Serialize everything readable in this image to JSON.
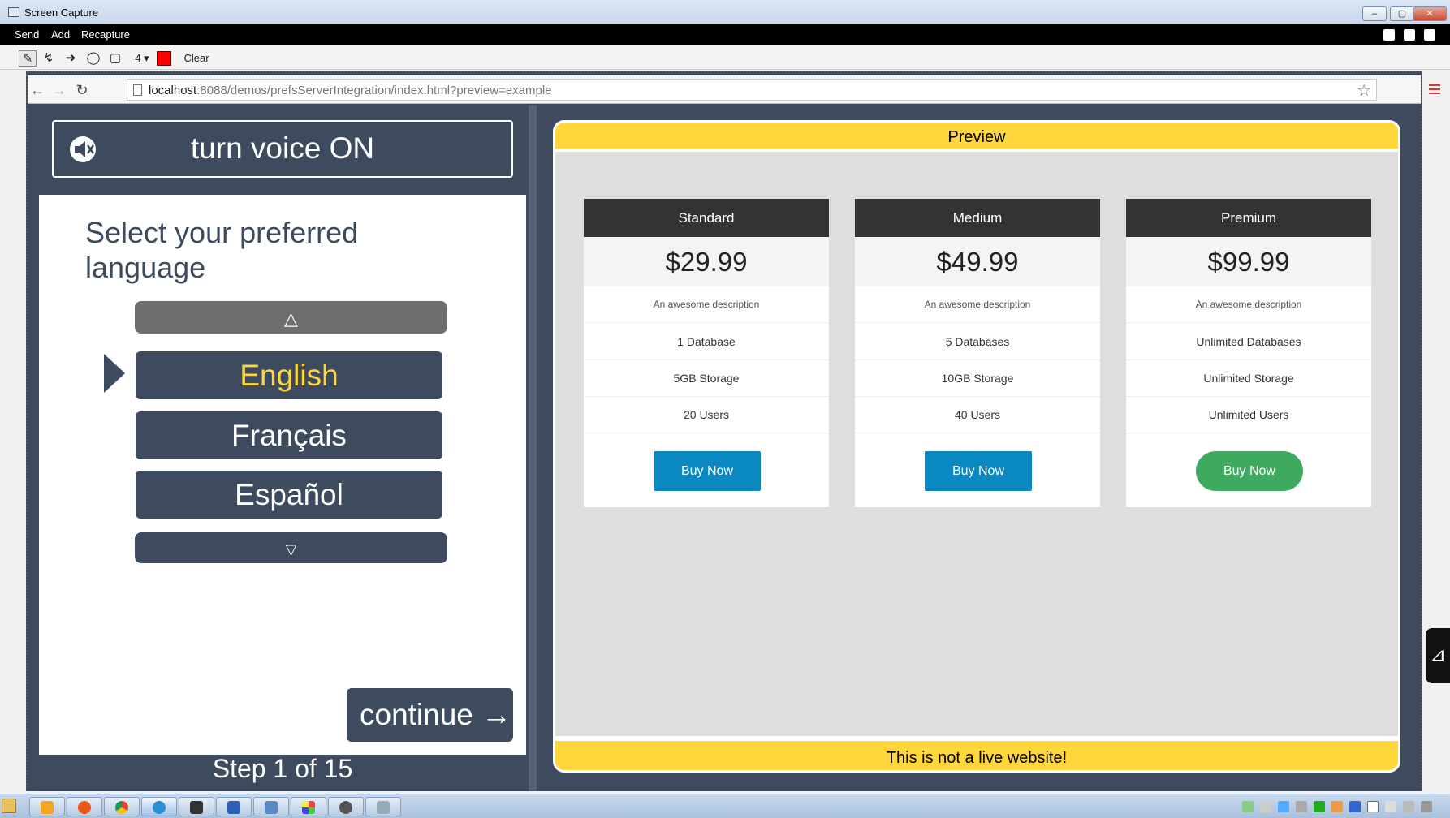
{
  "window": {
    "title": "Screen Capture",
    "controls": {
      "minimize": "–",
      "maximize": "▢",
      "close": "✕"
    }
  },
  "menu": {
    "items": [
      "Send",
      "Add",
      "Recapture"
    ],
    "icons": [
      "document-icon",
      "download-icon",
      "print-icon"
    ]
  },
  "toolbar": {
    "tools": [
      "pen-icon",
      "curve-icon",
      "arrow-icon",
      "circle-icon",
      "rectangle-icon"
    ],
    "line_width": "4 ▾",
    "color": "#ff0000",
    "clear_label": "Clear"
  },
  "browser": {
    "back": "←",
    "forward": "→",
    "reload": "↻",
    "url_host": "localhost",
    "url_rest": ":8088/demos/prefsServerIntegration/index.html?preview=example",
    "star": "☆"
  },
  "prefs": {
    "voice_button_label": "turn voice ON",
    "prompt": "Select your preferred language",
    "scroll_up": "△",
    "scroll_down": "▽",
    "languages": [
      {
        "label": "English",
        "selected": true
      },
      {
        "label": "Français",
        "selected": false
      },
      {
        "label": "Español",
        "selected": false
      }
    ],
    "continue_label": "continue →",
    "step_label": "Step 1 of 15",
    "selected_color": "#ffd73b",
    "panel_color": "#3e4a5e"
  },
  "preview": {
    "header": "Preview",
    "footer": "This is not a live website!",
    "accent": "#ffd73b",
    "plans": [
      {
        "name": "Standard",
        "price": "$29.99",
        "description": "An awesome description",
        "features": [
          "1 Database",
          "5GB Storage",
          "20 Users"
        ],
        "button": "Buy Now",
        "button_color": "#0a88c1"
      },
      {
        "name": "Medium",
        "price": "$49.99",
        "description": "An awesome description",
        "features": [
          "5 Databases",
          "10GB Storage",
          "40 Users"
        ],
        "button": "Buy Now",
        "button_color": "#0a88c1"
      },
      {
        "name": "Premium",
        "price": "$99.99",
        "description": "An awesome description",
        "features": [
          "Unlimited Databases",
          "Unlimited Storage",
          "Unlimited Users"
        ],
        "button": "Buy Now",
        "button_color": "#3daa60"
      }
    ]
  },
  "side_tab": {
    "icon": "puzzle-icon",
    "glyph": "⊿"
  },
  "taskbar": {
    "apps": [
      "windows-explorer-icon",
      "media-player-icon",
      "firefox-icon",
      "chrome-icon",
      "internet-explorer-icon",
      "terminal-icon",
      "word-icon",
      "remote-desktop-icon",
      "paint-icon",
      "settings-icon",
      "screen-capture-icon"
    ],
    "tray": [
      "network-icon",
      "lock-icon",
      "mail-icon",
      "drive-icon",
      "monitor-icon",
      "security-icon",
      "bluetooth-icon",
      "battery-icon",
      "wifi-icon",
      "signal-icon",
      "volume-icon"
    ]
  }
}
